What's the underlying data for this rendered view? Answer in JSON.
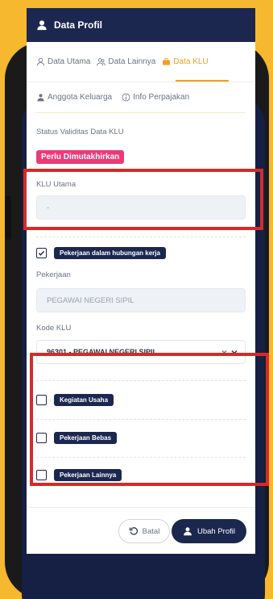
{
  "header": {
    "title": "Data Profil"
  },
  "tabs": [
    {
      "label": "Data Utama",
      "icon": "user-icon"
    },
    {
      "label": "Data Lainnya",
      "icon": "users-icon"
    },
    {
      "label": "Data KLU",
      "icon": "briefcase-icon",
      "active": true
    },
    {
      "label": "Anggota Keluarga",
      "icon": "family-icon"
    },
    {
      "label": "Info Perpajakan",
      "icon": "info-icon"
    }
  ],
  "status": {
    "label": "Status Validitas Data KLU",
    "badge": "Perlu Dimutakhirkan"
  },
  "klu_utama": {
    "label": "KLU Utama",
    "value": "-"
  },
  "pekerjaan_hubungan_kerja": {
    "label": "Pekerjaan dalam hubungan kerja",
    "checked": true
  },
  "pekerjaan": {
    "label": "Pekerjaan",
    "value": "PEGAWAI NEGERI SIPIL"
  },
  "kode_klu": {
    "label": "Kode KLU",
    "value": "96301 - PEGAWAI NEGERI SIPIL"
  },
  "kegiatan_usaha": {
    "label": "Kegiatan Usaha",
    "checked": false
  },
  "pekerjaan_bebas": {
    "label": "Pekerjaan Bebas",
    "checked": false
  },
  "pekerjaan_lainnya": {
    "label": "Pekerjaan Lainnya",
    "checked": false
  },
  "buttons": {
    "cancel": "Batal",
    "submit": "Ubah Profil"
  },
  "colors": {
    "accent": "#f0a11e",
    "navy": "#1c2750",
    "badge": "#ec3a78",
    "highlight": "#d42a2a"
  }
}
